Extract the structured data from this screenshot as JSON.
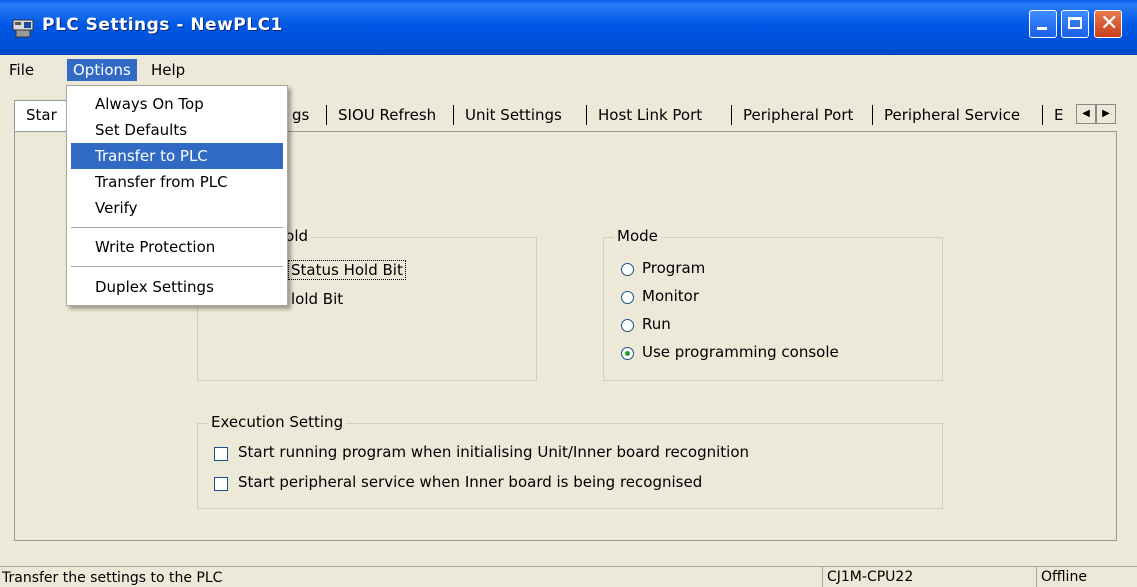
{
  "window": {
    "title": "PLC Settings - NewPLC1",
    "icon": "plc-app-icon"
  },
  "menubar": {
    "file": "File",
    "options": "Options",
    "help": "Help"
  },
  "options_menu": {
    "items": [
      "Always On Top",
      "Set Defaults",
      "Transfer to PLC",
      "Transfer from PLC",
      "Verify",
      "Write Protection",
      "Duplex Settings"
    ],
    "highlighted": "Transfer to PLC"
  },
  "tabs": {
    "first_partial": "Star",
    "timings_partial": "gs",
    "items": [
      "SIOU Refresh",
      "Unit Settings",
      "Host Link Port",
      "Peripheral Port",
      "Peripheral Service"
    ],
    "last_partial": "E"
  },
  "hold_group": {
    "title_partial": "lold",
    "option1_partial": "Status Hold Bit",
    "option2_partial": "lold Bit"
  },
  "mode_group": {
    "title": "Mode",
    "options": [
      "Program",
      "Monitor",
      "Run",
      "Use programming console"
    ],
    "selected": "Use programming console"
  },
  "execution_group": {
    "title": "Execution Setting",
    "options": [
      "Start running program when initialising Unit/Inner board recognition",
      "Start peripheral service when Inner board is being recognised"
    ]
  },
  "statusbar": {
    "message": "Transfer the settings to the PLC",
    "cpu": "CJ1M-CPU22",
    "state": "Offline"
  },
  "colors": {
    "titlebar": "#0058E6",
    "menu_highlight": "#316AC5",
    "window_bg": "#ECE9D8"
  }
}
